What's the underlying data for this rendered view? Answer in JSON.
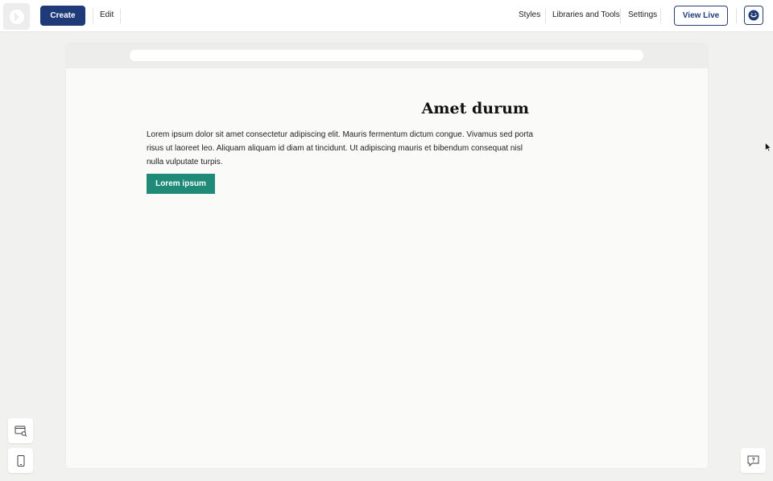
{
  "topbar": {
    "create_label": "Create",
    "edit_label": "Edit",
    "styles_label": "Styles",
    "libraries_label": "Libraries and Tools",
    "settings_label": "Settings",
    "view_live_label": "View Live"
  },
  "canvas": {
    "url_value": "",
    "heading": "Amet durum",
    "paragraph": "Lorem ipsum dolor sit amet consectetur adipiscing elit. Mauris fermentum dictum congue. Vivamus sed porta risus ut laoreet leo. Aliquam aliquam id diam at tincidunt. Ut adipiscing mauris et bibendum consequat nisl nulla vulputate turpis.",
    "button_label": "Lorem ipsum"
  },
  "colors": {
    "primary": "#1f3a78",
    "accent": "#1f8a78"
  },
  "icons": {
    "logo": "logo-icon",
    "avatar": "smiley-icon",
    "preview": "browser-search-icon",
    "mobile": "mobile-icon",
    "help": "help-chat-icon"
  }
}
